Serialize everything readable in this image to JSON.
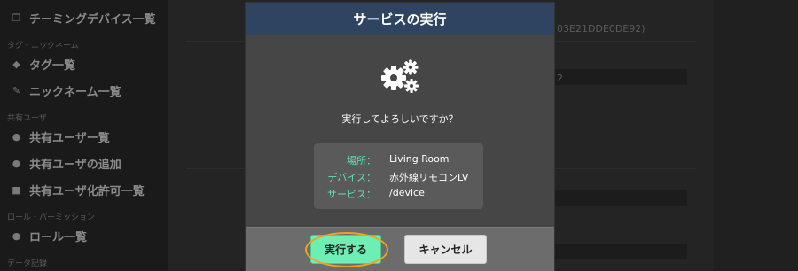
{
  "sidebar": {
    "top_item": "チーミングデバイス一覧",
    "section_tags": "タグ・ニックネーム",
    "tag_list": "タグ一覧",
    "nickname_list": "ニックネーム一覧",
    "section_shared": "共有ユーザ",
    "shared_users": "共有ユーザー覧",
    "add_shared_user": "共有ユーザの追加",
    "shared_permission_list": "共有ユーザ化許可一覧",
    "section_roles": "ロール・パーミッション",
    "role_list": "ロール一覧",
    "section_data": "データ記録"
  },
  "background": {
    "partial_id": "03E21DDE0DE92)",
    "partial_value": "2"
  },
  "modal": {
    "title": "サービスの実行",
    "question": "実行してよろしいですか？",
    "info": {
      "place_label": "場所：",
      "place_value": "Living Room",
      "device_label": "デバイス：",
      "device_value": "赤外線リモコンLV",
      "service_label": "サービス：",
      "service_value": "/device"
    },
    "execute_label": "実行する",
    "cancel_label": "キャンセル",
    "gear_icon": "gears-icon"
  },
  "colors": {
    "header": "#2e4460",
    "accent_green": "#6eeeb4",
    "label_green": "#5ee2b2",
    "highlight": "#f0a21e"
  }
}
